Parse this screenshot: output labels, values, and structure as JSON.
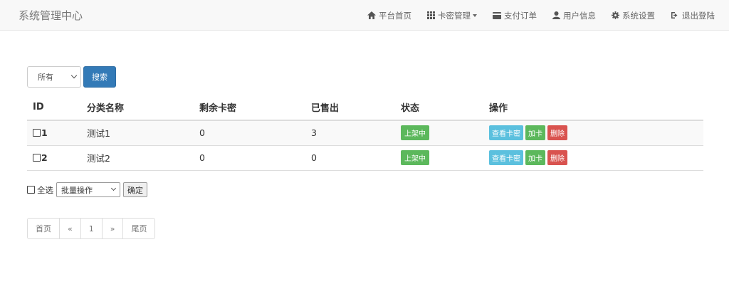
{
  "navbar": {
    "brand": "系统管理中心",
    "items": [
      {
        "label": "平台首页",
        "icon": "home-icon"
      },
      {
        "label": "卡密管理",
        "icon": "grid-icon"
      },
      {
        "label": "支付订单",
        "icon": "card-icon"
      },
      {
        "label": "用户信息",
        "icon": "user-icon"
      },
      {
        "label": "系统设置",
        "icon": "gear-icon"
      },
      {
        "label": "退出登陆",
        "icon": "logout-icon"
      }
    ]
  },
  "filter": {
    "selected": "所有",
    "search_label": "搜索"
  },
  "table": {
    "headers": [
      "ID",
      "分类名称",
      "剩余卡密",
      "已售出",
      "状态",
      "操作"
    ],
    "rows": [
      {
        "id": "1",
        "name": "测试1",
        "remaining": "0",
        "sold": "3",
        "status": "上架中"
      },
      {
        "id": "2",
        "name": "测试2",
        "remaining": "0",
        "sold": "0",
        "status": "上架中"
      }
    ],
    "actions": {
      "view": "查看卡密",
      "add": "加卡",
      "delete": "删除"
    }
  },
  "batch": {
    "select_all": "全选",
    "selected": "批量操作",
    "confirm": "确定"
  },
  "pagination": [
    "首页",
    "«",
    "1",
    "»",
    "尾页"
  ],
  "colors": {
    "primary": "#337ab7",
    "success": "#5cb85c",
    "info": "#5bc0de",
    "danger": "#d9534f"
  }
}
